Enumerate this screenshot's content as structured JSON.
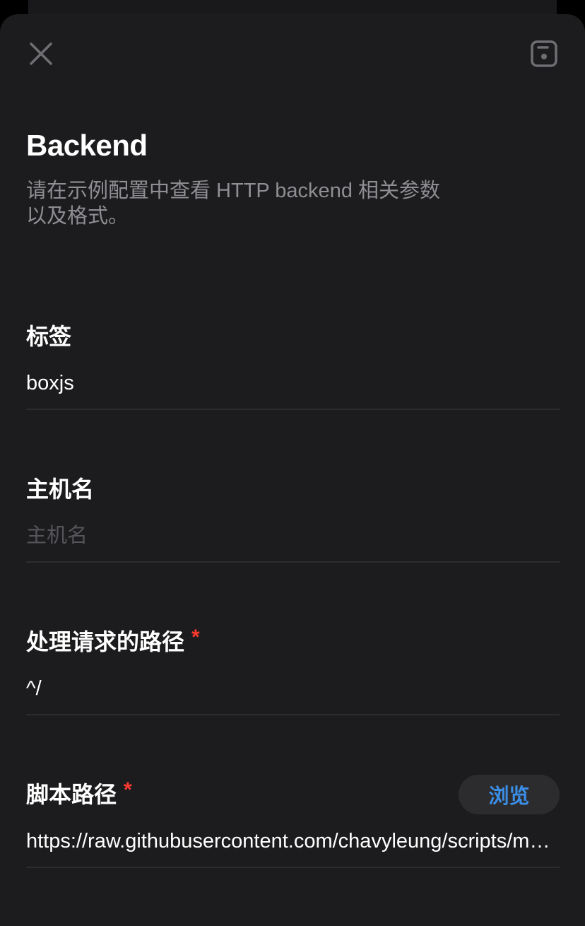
{
  "header": {
    "close_icon": "close-icon",
    "save_icon": "save-icon"
  },
  "title": "Backend",
  "subtitle": "请在示例配置中查看 HTTP backend 相关参数\n以及格式。",
  "fields": {
    "tag": {
      "label": "标签",
      "value": "boxjs",
      "placeholder": ""
    },
    "hostname": {
      "label": "主机名",
      "value": "",
      "placeholder": "主机名"
    },
    "path": {
      "label": "处理请求的路径",
      "required_mark": "*",
      "value": "^/",
      "placeholder": ""
    },
    "script_path": {
      "label": "脚本路径",
      "required_mark": "*",
      "browse_label": "浏览",
      "value": "https://raw.githubusercontent.com/chavyleung/scripts/master/box/chavy.boxjs.js",
      "placeholder": ""
    }
  },
  "colors": {
    "background": "#1c1c1e",
    "accent": "#3a8ee6",
    "required": "#ff3b30",
    "secondary_text": "#8e8e93"
  }
}
